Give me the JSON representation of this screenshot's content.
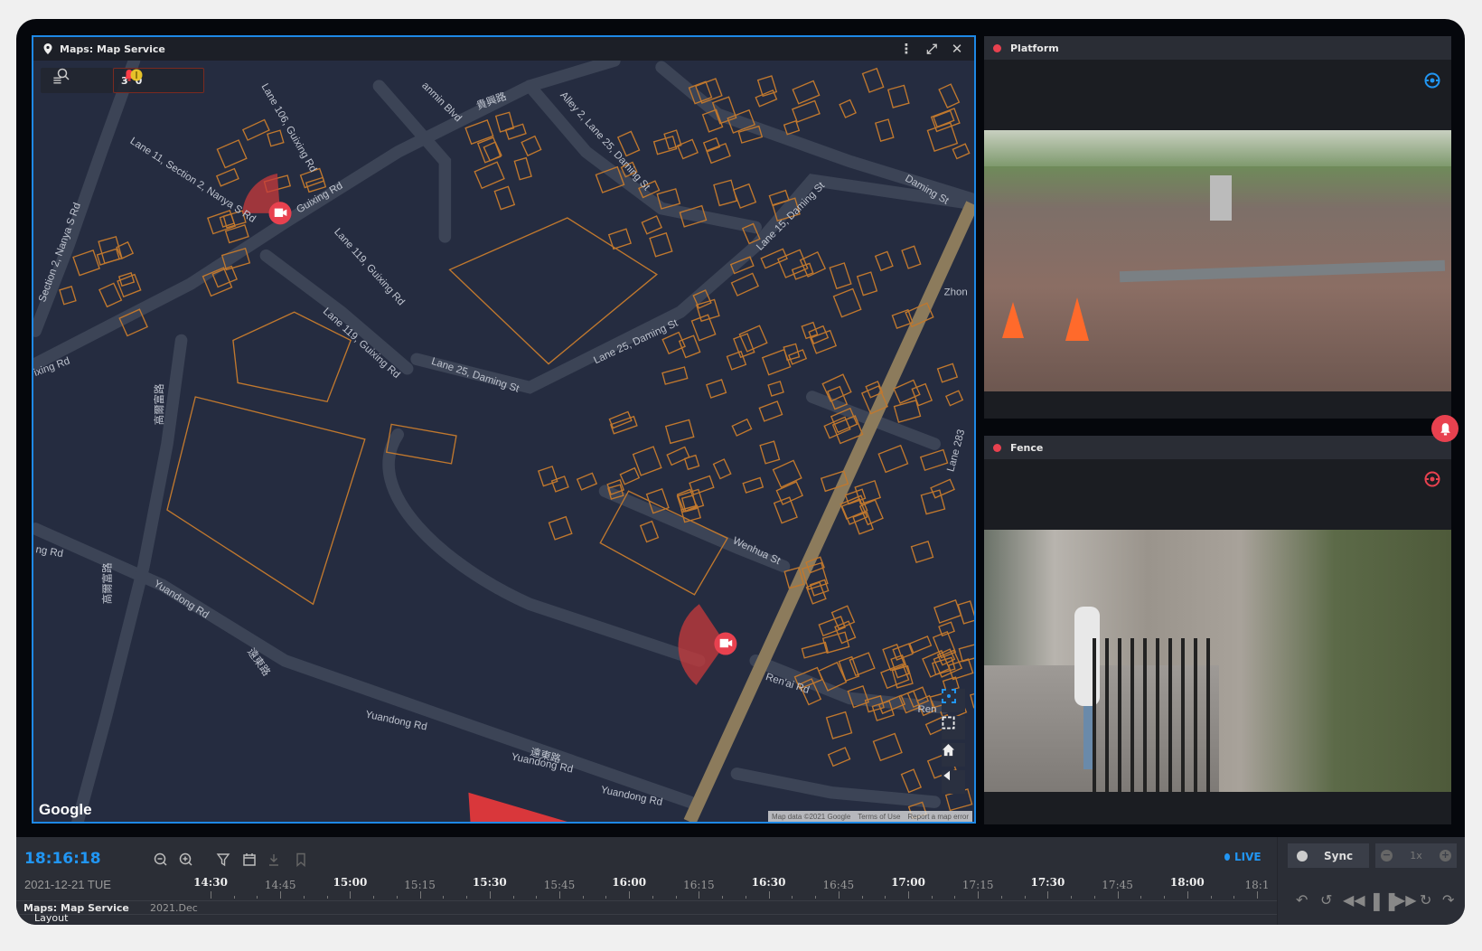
{
  "map_panel": {
    "title": "Maps: Map Service",
    "alarm_count": "3",
    "warning_count": "0",
    "street_labels": [
      "Guixing Rd",
      "Lane 106, Guixing Rd",
      "Lane 11, Section 2, Nanya S Rd",
      "Section 2, Nanya S Rd",
      "Lane 119, Guixing Rd",
      "Lane 119, Guixing Rd",
      "Lane 25, Daming St",
      "Lane 25, Daming St",
      "Alley 2, Lane 25, Daming St",
      "Lane 15, Daming St",
      "Daming St",
      "Wenhua St",
      "Yuandong Rd",
      "Yuandong Rd",
      "Yuandong Rd",
      "Yuandong Rd",
      "Ren'ai Rd",
      "Ren",
      "Zhon",
      "ixing Rd",
      "ng Rd",
      "貴興路",
      "遠東路",
      "遠東路",
      "高爾富路",
      "高爾富路",
      "Lane 283",
      "anmin Blvd"
    ],
    "google": "Google",
    "attribution": [
      "Map data ©2021 Google",
      "Terms of Use",
      "Report a map error"
    ]
  },
  "cameras": [
    {
      "name": "Platform",
      "status_color": "#e8414f",
      "ptz_color": "#2196f3"
    },
    {
      "name": "Fence",
      "status_color": "#e8414f",
      "ptz_color": "#e8414f"
    }
  ],
  "timeline": {
    "current_time": "18:16:18",
    "date": "2021-12-21 TUE",
    "live_label": "LIVE",
    "sync_label": "Sync",
    "speed": "1x",
    "track_name": "Maps: Map Service",
    "month": "2021.Dec",
    "layout_label": "Layout",
    "ticks": [
      "14:30",
      "14:45",
      "15:00",
      "15:15",
      "15:30",
      "15:45",
      "16:00",
      "16:15",
      "16:30",
      "16:45",
      "17:00",
      "17:15",
      "17:30",
      "17:45",
      "18:00",
      "18:1"
    ]
  },
  "colors": {
    "accent": "#1e88e5",
    "alarm": "#e8414f",
    "building": "#c0782e",
    "road": "#3c4456",
    "highway": "#8c7b5c"
  }
}
